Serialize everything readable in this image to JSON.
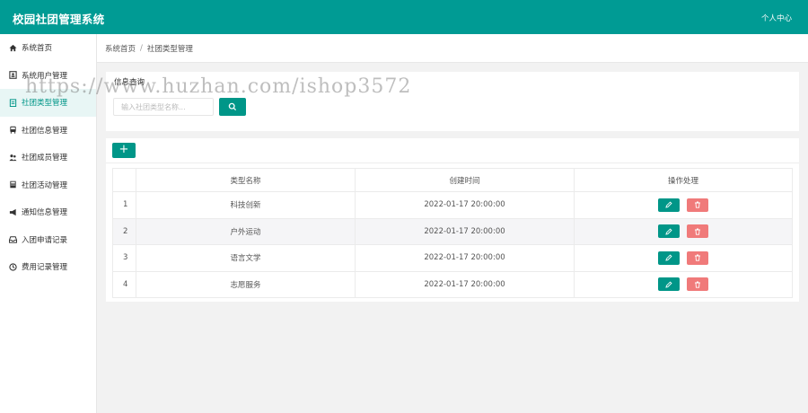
{
  "header": {
    "app_title": "校园社团管理系统",
    "user_menu": "个人中心"
  },
  "sidebar": {
    "items": [
      {
        "label": "系统首页",
        "icon": "home-icon"
      },
      {
        "label": "系统用户管理",
        "icon": "user-card-icon"
      },
      {
        "label": "社团类型管理",
        "icon": "clipboard-icon"
      },
      {
        "label": "社团信息管理",
        "icon": "bus-icon"
      },
      {
        "label": "社团成员管理",
        "icon": "users-icon"
      },
      {
        "label": "社团活动管理",
        "icon": "calculator-icon"
      },
      {
        "label": "通知信息管理",
        "icon": "megaphone-icon"
      },
      {
        "label": "入团申请记录",
        "icon": "inbox-icon"
      },
      {
        "label": "费用记录管理",
        "icon": "clock-icon"
      }
    ],
    "active_index": 2
  },
  "breadcrumb": {
    "home": "系统首页",
    "separator": "/",
    "current": "社团类型管理"
  },
  "search": {
    "title": "信息查询",
    "placeholder": "输入社团类型名称..."
  },
  "toolbar": {
    "add_label": "+"
  },
  "table": {
    "headers": {
      "name": "类型名称",
      "created": "创建时间",
      "actions": "操作处理"
    },
    "rows": [
      {
        "index": "1",
        "name": "科技创新",
        "created": "2022-01-17 20:00:00"
      },
      {
        "index": "2",
        "name": "户外运动",
        "created": "2022-01-17 20:00:00"
      },
      {
        "index": "3",
        "name": "语言文学",
        "created": "2022-01-17 20:00:00"
      },
      {
        "index": "4",
        "name": "志愿服务",
        "created": "2022-01-17 20:00:00"
      }
    ]
  },
  "watermark": "https://www.huzhan.com/ishop3572",
  "colors": {
    "primary": "#009b94",
    "danger": "#f07a7a",
    "active_bg": "#e8f6f5"
  }
}
